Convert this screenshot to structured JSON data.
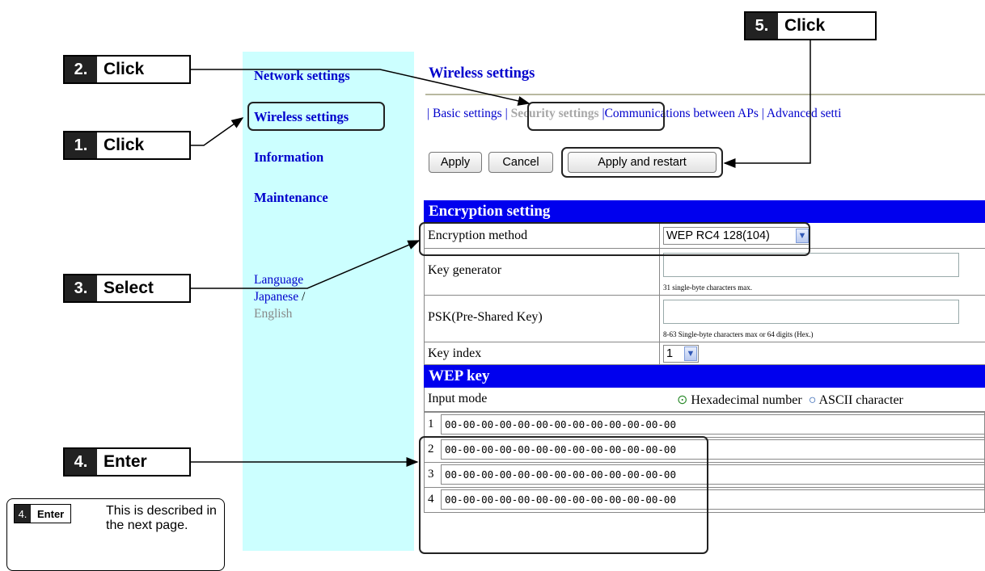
{
  "nav": {
    "items": [
      "Network settings",
      "Wireless settings",
      "Information",
      "Maintenance"
    ],
    "language_label": "Language",
    "lang_japanese": "Japanese",
    "lang_sep": "/",
    "lang_english": "English"
  },
  "main": {
    "title": "Wireless settings",
    "tabs": [
      "Basic settings",
      "Security settings",
      "Communications between APs",
      "Advanced setti"
    ],
    "tab_sep": "|",
    "buttons": {
      "apply": "Apply",
      "cancel": "Cancel",
      "apply_restart": "Apply and restart"
    }
  },
  "encryption": {
    "header": "Encryption setting",
    "method_label": "Encryption method",
    "method_value": "WEP RC4 128(104)",
    "keygen_label": "Key generator",
    "keygen_hint": "31 single-byte characters max.",
    "psk_label": "PSK(Pre-Shared Key)",
    "psk_hint": "8-63 Single-byte characters max or 64 digits (Hex.)",
    "keyindex_label": "Key index",
    "keyindex_value": "1"
  },
  "wep": {
    "header": "WEP key",
    "input_mode_label": "Input mode",
    "mode_hex": "Hexadecimal number",
    "mode_ascii": "ASCII character",
    "mode_selected": "Hexadecimal number",
    "keys": [
      {
        "num": "1",
        "value": "00-00-00-00-00-00-00-00-00-00-00-00-00"
      },
      {
        "num": "2",
        "value": "00-00-00-00-00-00-00-00-00-00-00-00-00"
      },
      {
        "num": "3",
        "value": "00-00-00-00-00-00-00-00-00-00-00-00-00"
      },
      {
        "num": "4",
        "value": "00-00-00-00-00-00-00-00-00-00-00-00-00"
      }
    ]
  },
  "callouts": [
    {
      "num": "1.",
      "text": "Click"
    },
    {
      "num": "2.",
      "text": "Click"
    },
    {
      "num": "3.",
      "text": "Select"
    },
    {
      "num": "4.",
      "text": "Enter"
    },
    {
      "num": "5.",
      "text": "Click"
    }
  ],
  "note": {
    "badge_num": "4.",
    "badge_text": "Enter",
    "text": "This is described in the next page."
  },
  "colors": {
    "nav_bg": "#ccffff",
    "link": "#0000cc",
    "section_header": "#0000ee"
  }
}
